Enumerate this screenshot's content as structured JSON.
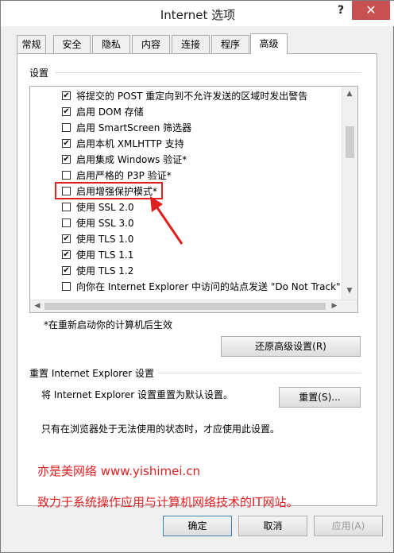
{
  "window": {
    "title": "Internet 选项",
    "help": "?",
    "close": "✕"
  },
  "tabs": [
    "常规",
    "安全",
    "隐私",
    "内容",
    "连接",
    "程序",
    "高级"
  ],
  "settings": {
    "group_label": "设置",
    "items": [
      {
        "label": "将提交的 POST 重定向到不允许发送的区域时发出警告",
        "checked": true
      },
      {
        "label": "启用 DOM 存储",
        "checked": true
      },
      {
        "label": "启用 SmartScreen 筛选器",
        "checked": false
      },
      {
        "label": "启用本机 XMLHTTP 支持",
        "checked": true
      },
      {
        "label": "启用集成 Windows 验证*",
        "checked": true
      },
      {
        "label": "启用严格的 P3P 验证*",
        "checked": false
      },
      {
        "label": "启用增强保护模式*",
        "checked": false
      },
      {
        "label": "使用 SSL 2.0",
        "checked": false
      },
      {
        "label": "使用 SSL 3.0",
        "checked": false
      },
      {
        "label": "使用 TLS 1.0",
        "checked": true
      },
      {
        "label": "使用 TLS 1.1",
        "checked": true
      },
      {
        "label": "使用 TLS 1.2",
        "checked": true
      },
      {
        "label": "向你在 Internet Explorer 中访问的站点发送 \"Do Not Track\" 请求",
        "checked": false
      }
    ],
    "restart_note": "*在重新启动你的计算机后生效",
    "restore_button": "还原高级设置(R)"
  },
  "reset": {
    "group_label": "重置 Internet Explorer 设置",
    "description": "将 Internet Explorer 设置重置为默认设置。",
    "button": "重置(S)...",
    "note": "只有在浏览器处于无法使用的状态时，才应使用此设置。"
  },
  "watermark": {
    "line1": "亦是美网络 www.yishimei.cn",
    "line2": "致力于系统操作应用与计算机网络技术的IT网站。"
  },
  "footer": {
    "ok": "确定",
    "cancel": "取消",
    "apply": "应用(A)"
  },
  "colors": {
    "highlight": "#e02020",
    "default_button_border": "#3c7fb1"
  }
}
